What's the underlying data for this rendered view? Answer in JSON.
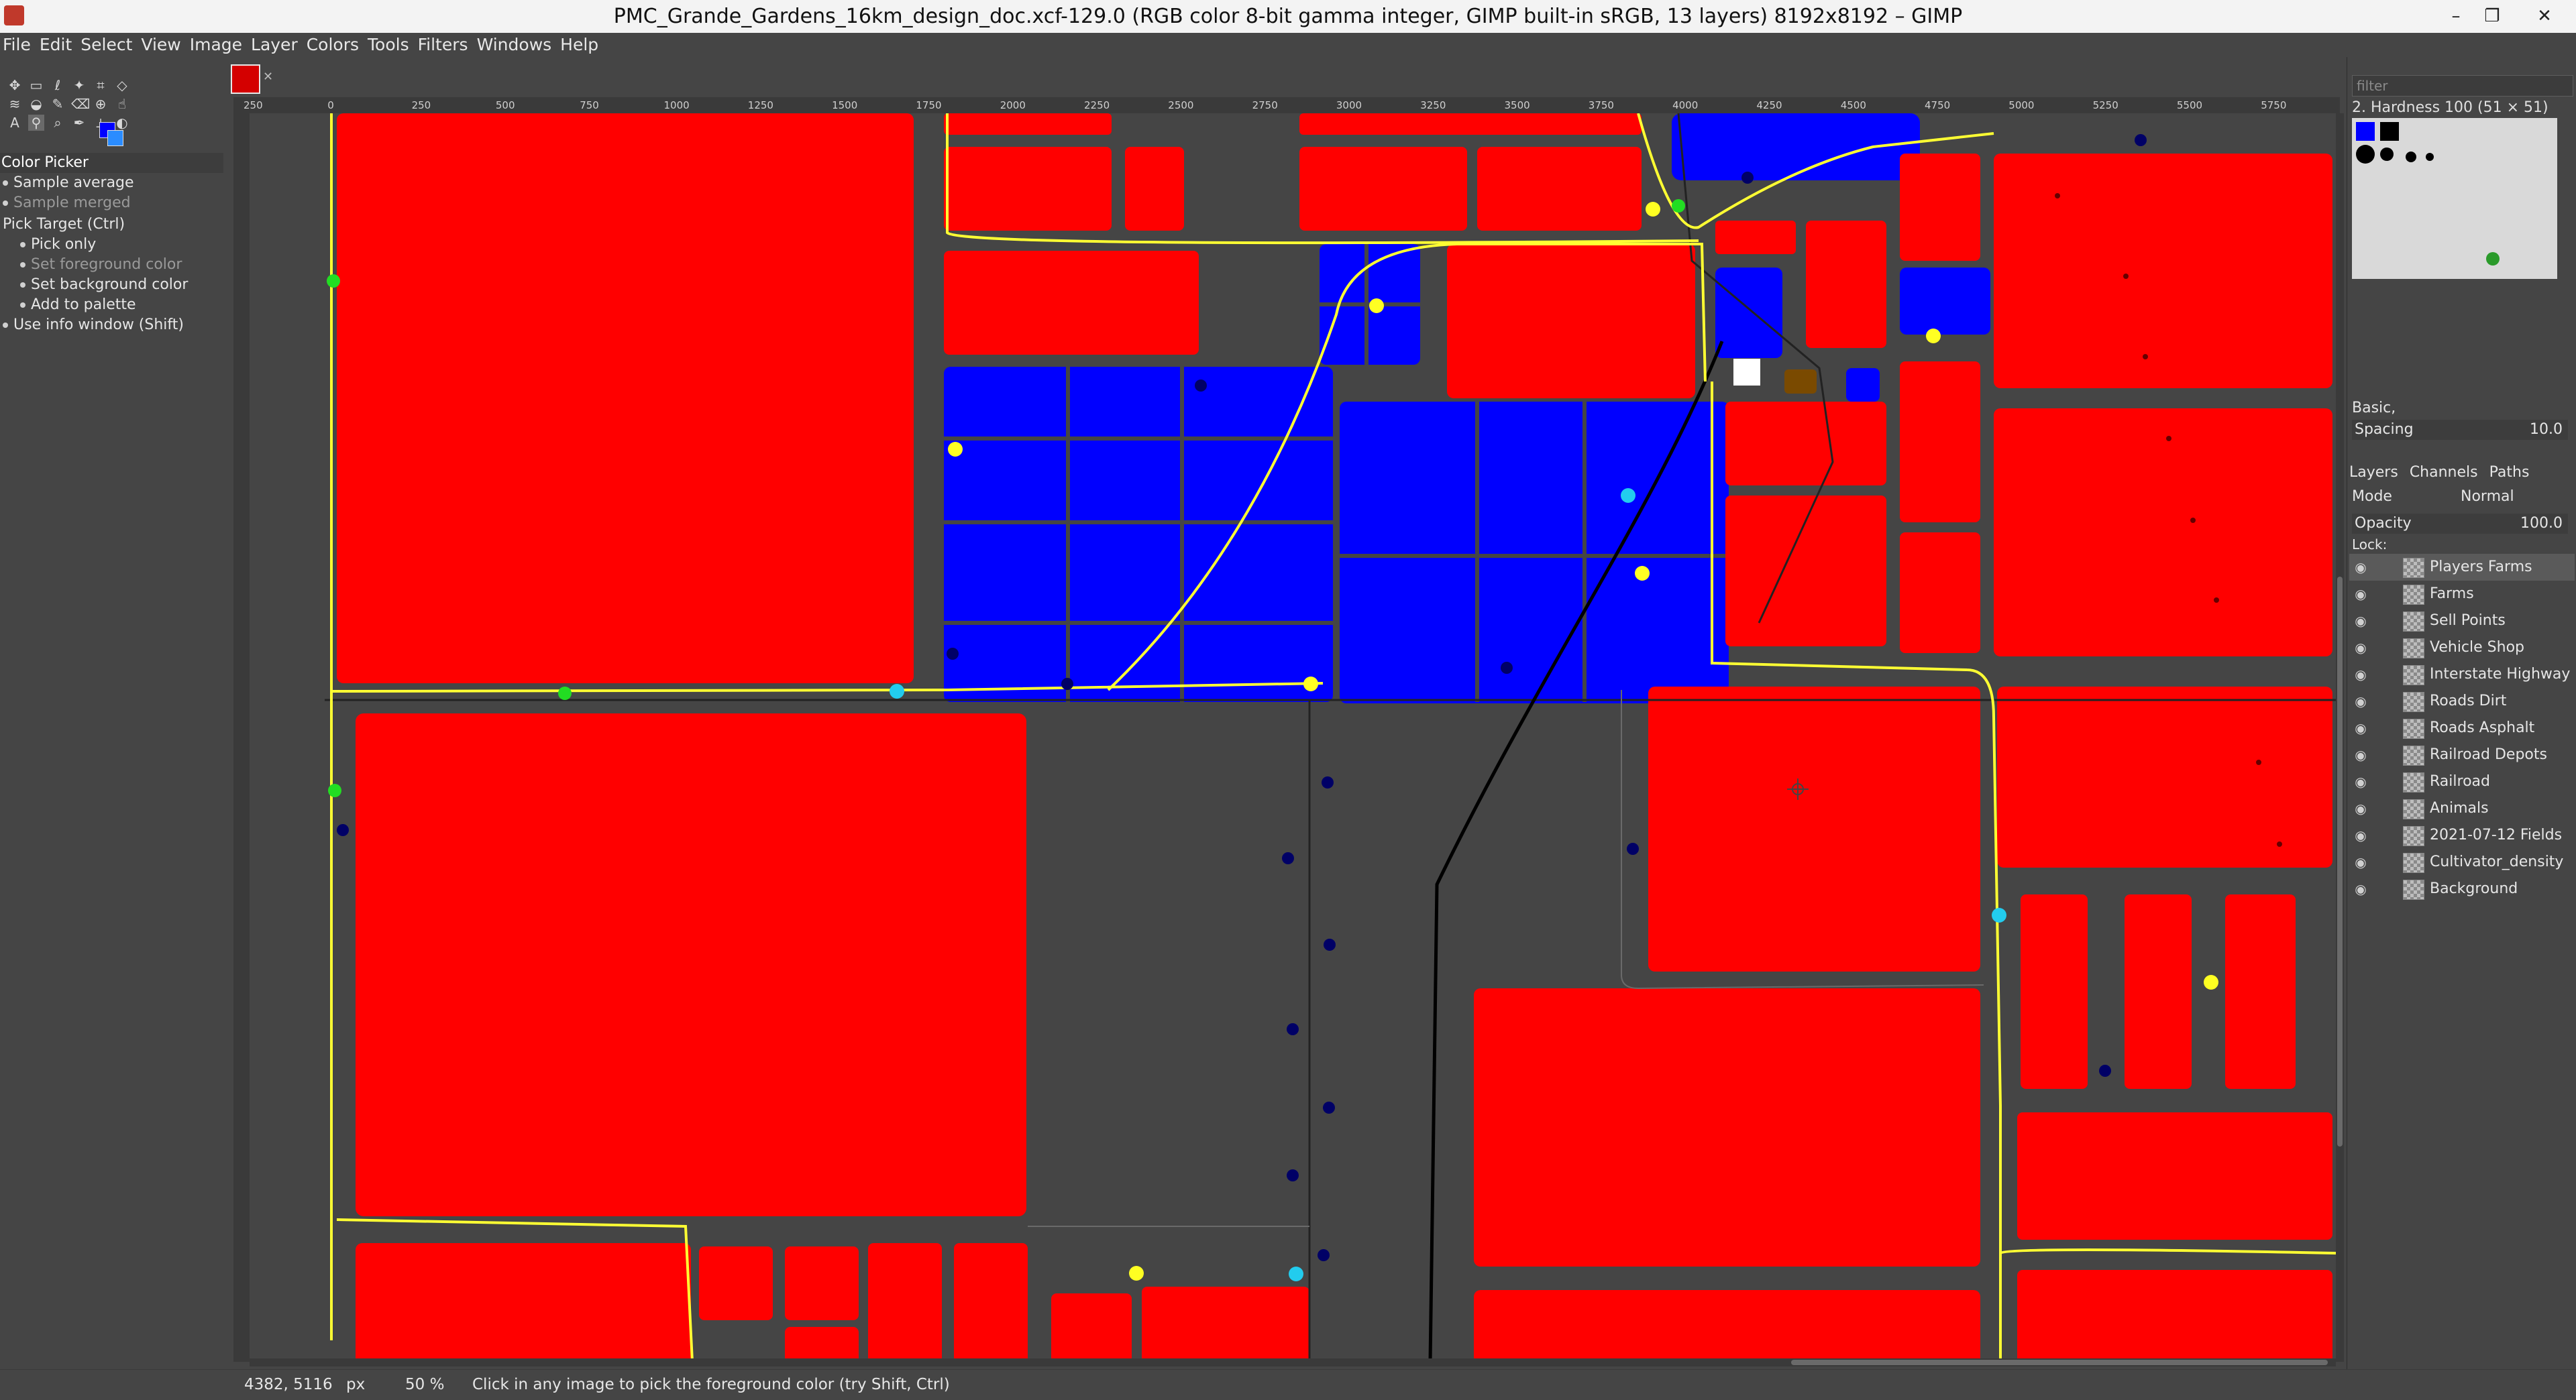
{
  "window": {
    "title": "PMC_Grande_Gardens_16km_design_doc.xcf-129.0 (RGB color 8-bit gamma integer, GIMP built-in sRGB, 13 layers) 8192x8192 – GIMP",
    "minimize": "–",
    "maximize": "❐",
    "close": "✕"
  },
  "menu": [
    "File",
    "Edit",
    "Select",
    "View",
    "Image",
    "Layer",
    "Colors",
    "Tools",
    "Filters",
    "Windows",
    "Help"
  ],
  "tool_options": {
    "title": "Color Picker",
    "sample_average": "Sample average",
    "sample_merged": "Sample merged",
    "pick_target": "Pick Target  (Ctrl)",
    "pick_only": "Pick only",
    "set_fg": "Set foreground color",
    "set_bg": "Set background color",
    "add_palette": "Add to palette",
    "use_info": "Use info window  (Shift)"
  },
  "colors": {
    "foreground": "#0000ff",
    "background": "#2a8cff"
  },
  "ruler": [
    "250",
    "0",
    "250",
    "500",
    "750",
    "1000",
    "1250",
    "1500",
    "1750",
    "2000",
    "2250",
    "2500",
    "2750",
    "3000",
    "3250",
    "3500",
    "3750",
    "4000",
    "4250",
    "4500",
    "4750",
    "5000",
    "5250",
    "5500",
    "5750"
  ],
  "brushes": {
    "filter_placeholder": "filter",
    "selected": "2. Hardness 100 (51 × 51)",
    "preset": "Basic,",
    "spacing_label": "Spacing",
    "spacing_value": "10.0"
  },
  "layers_panel": {
    "tabs": [
      "Layers",
      "Channels",
      "Paths"
    ],
    "mode_label": "Mode",
    "mode_value": "Normal",
    "opacity_label": "Opacity",
    "opacity_value": "100.0",
    "lock_label": "Lock:",
    "layers": [
      {
        "name": "Players Farms",
        "active": true
      },
      {
        "name": "Farms"
      },
      {
        "name": "Sell Points"
      },
      {
        "name": "Vehicle Shop"
      },
      {
        "name": "Interstate Highway"
      },
      {
        "name": "Roads Dirt"
      },
      {
        "name": "Roads Asphalt"
      },
      {
        "name": "Railroad Depots"
      },
      {
        "name": "Railroad"
      },
      {
        "name": "Animals"
      },
      {
        "name": "2021-07-12 Fields"
      },
      {
        "name": "Cultivator_density"
      },
      {
        "name": "Background"
      }
    ]
  },
  "status": {
    "coords": "4382, 5116",
    "unit": "px",
    "zoom": "50 %",
    "message": "Click in any image to pick the foreground color (try Shift, Ctrl)"
  }
}
